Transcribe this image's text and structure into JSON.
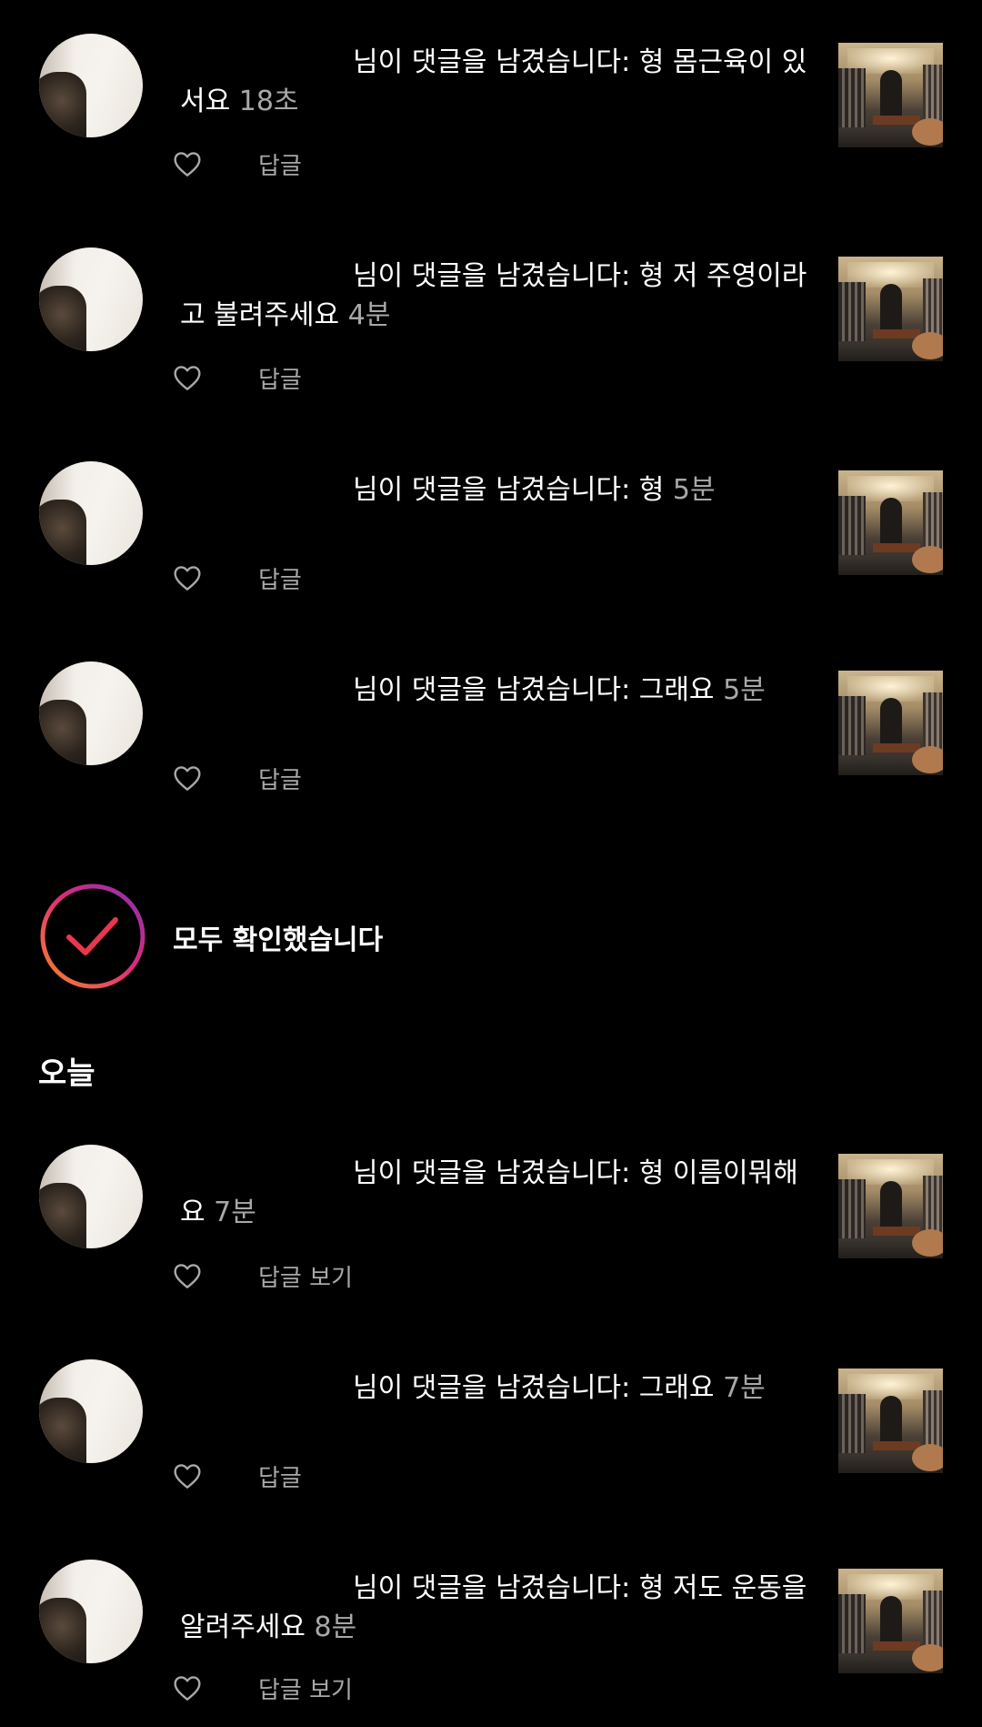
{
  "notifications_top": [
    {
      "action_text": "님이 댓글을 남겼습니다: 형 몸근육이 있",
      "action_text_cont": "서요",
      "time": "18초",
      "reply_label": "답글"
    },
    {
      "action_text": "님이 댓글을 남겼습니다: 형 저 주영이라",
      "action_text_cont": "고 불려주세요",
      "time": "4분",
      "reply_label": "답글"
    },
    {
      "action_text": "님이 댓글을 남겼습니다: 형",
      "time": "5분",
      "reply_label": "답글"
    },
    {
      "action_text": "님이 댓글을 남겼습니다: 그래요",
      "time": "5분",
      "reply_label": "답글"
    }
  ],
  "caught_up": {
    "label": "모두 확인했습니다"
  },
  "section": {
    "title": "오늘"
  },
  "notifications_today": [
    {
      "action_text": "님이 댓글을 남겼습니다: 형 이름이뭐해",
      "action_text_cont": "요",
      "time": "7분",
      "reply_label": "답글 보기"
    },
    {
      "action_text": "님이 댓글을 남겼습니다: 그래요",
      "time": "7분",
      "reply_label": "답글"
    },
    {
      "action_text": "님이 댓글을 남겼습니다: 형 저도 운동을",
      "action_text_cont": "알려주세요",
      "time": "8분",
      "reply_label": "답글 보기"
    }
  ],
  "colors": {
    "background": "#000000",
    "text_primary": "#ffffff",
    "text_secondary": "#a8a8a8",
    "caught_up_gradient_start": "#f58529",
    "caught_up_gradient_mid": "#dd2a7b",
    "caught_up_gradient_end": "#8134af",
    "check_color": "#e8374b"
  },
  "icons": {
    "like": "heart-outline-icon",
    "caught_up": "check-circle-icon"
  }
}
